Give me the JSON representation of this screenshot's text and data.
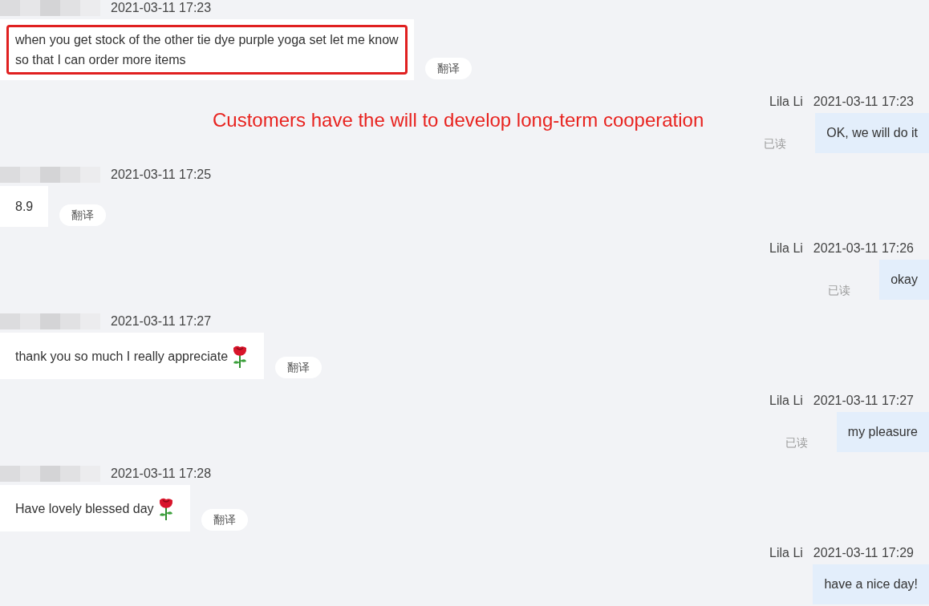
{
  "annotation": {
    "text": "Customers have the will to develop long-term cooperation"
  },
  "messages": [
    {
      "kind": "incoming",
      "time": "2021-03-11 17:23",
      "text": "when you get stock of the other tie dye purple yoga set let me know\nso that I can order more items",
      "highlighted": true,
      "has_rose": false,
      "translate": "翻译"
    },
    {
      "kind": "outgoing",
      "sender": "Lila Li",
      "time": "2021-03-11 17:23",
      "text": "OK, we will do it",
      "status": "已读"
    },
    {
      "kind": "incoming",
      "time": "2021-03-11 17:25",
      "text": "8.9",
      "highlighted": false,
      "has_rose": false,
      "translate": "翻译"
    },
    {
      "kind": "outgoing",
      "sender": "Lila Li",
      "time": "2021-03-11 17:26",
      "text": "okay",
      "status": "已读"
    },
    {
      "kind": "incoming",
      "time": "2021-03-11 17:27",
      "text": "thank you so much I really appreciate",
      "highlighted": false,
      "has_rose": true,
      "translate": "翻译"
    },
    {
      "kind": "outgoing",
      "sender": "Lila Li",
      "time": "2021-03-11 17:27",
      "text": "my pleasure",
      "status": "已读"
    },
    {
      "kind": "incoming",
      "time": "2021-03-11 17:28",
      "text": "Have lovely blessed day",
      "highlighted": false,
      "has_rose": true,
      "translate": "翻译"
    },
    {
      "kind": "outgoing",
      "sender": "Lila Li",
      "time": "2021-03-11 17:29",
      "text": "have a nice day!"
    }
  ]
}
